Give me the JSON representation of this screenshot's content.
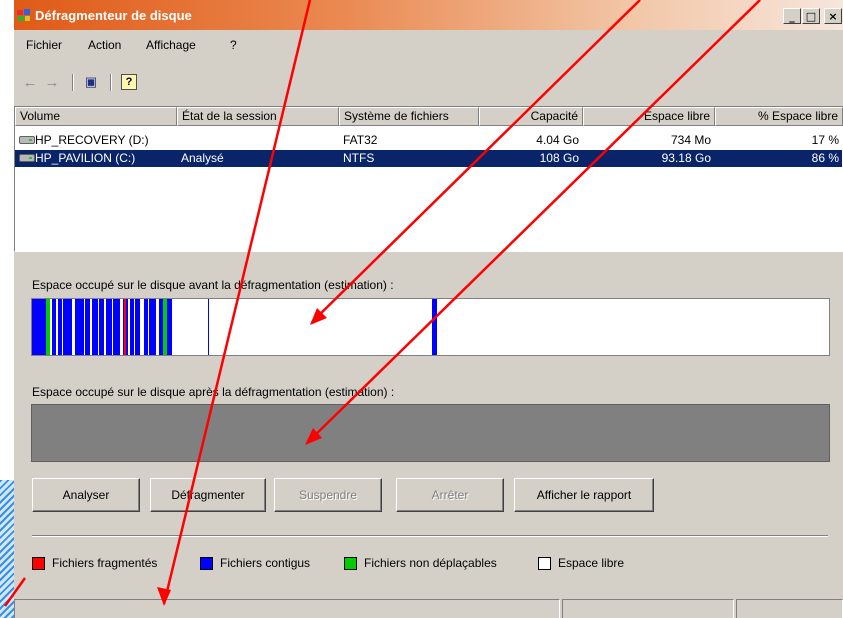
{
  "window": {
    "title": "Défragmenteur de disque",
    "minimize": "_",
    "maximize": "□",
    "close": "×"
  },
  "menu": [
    "Fichier",
    "Action",
    "Affichage",
    "?"
  ],
  "toolbar": {
    "back": "←",
    "forward": "→",
    "properties": "▣",
    "help": "?"
  },
  "columns": [
    "Volume",
    "État de la session",
    "Système de fichiers",
    "Capacité",
    "Espace libre",
    "% Espace libre"
  ],
  "rows": [
    {
      "volume": "HP_RECOVERY (D:)",
      "state": "",
      "fs": "FAT32",
      "capacity": "4.04 Go",
      "free": "734 Mo",
      "pct": "17 %",
      "selected": false
    },
    {
      "volume": "HP_PAVILION (C:)",
      "state": "Analysé",
      "fs": "NTFS",
      "capacity": "108 Go",
      "free": "93.18 Go",
      "pct": "86 %",
      "selected": true
    }
  ],
  "labels": {
    "before": "Espace occupé sur le disque avant la défragmentation (estimation) :",
    "after": "Espace occupé sur le disque après la défragmentation (estimation) :"
  },
  "buttons": {
    "analyze": "Analyser",
    "defrag": "Défragmenter",
    "pause": "Suspendre",
    "stop": "Arrêter",
    "report": "Afficher le rapport"
  },
  "legend": {
    "fragmented": "Fichiers fragmentés",
    "contiguous": "Fichiers contigus",
    "unmovable": "Fichiers non déplaçables",
    "free": "Espace libre"
  },
  "colors": {
    "fragmented": "#ff0000",
    "contiguous": "#0000ff",
    "unmovable": "#00cc00",
    "free": "#ffffff",
    "selection": "#0a246a",
    "annotation": "#ff0000"
  }
}
